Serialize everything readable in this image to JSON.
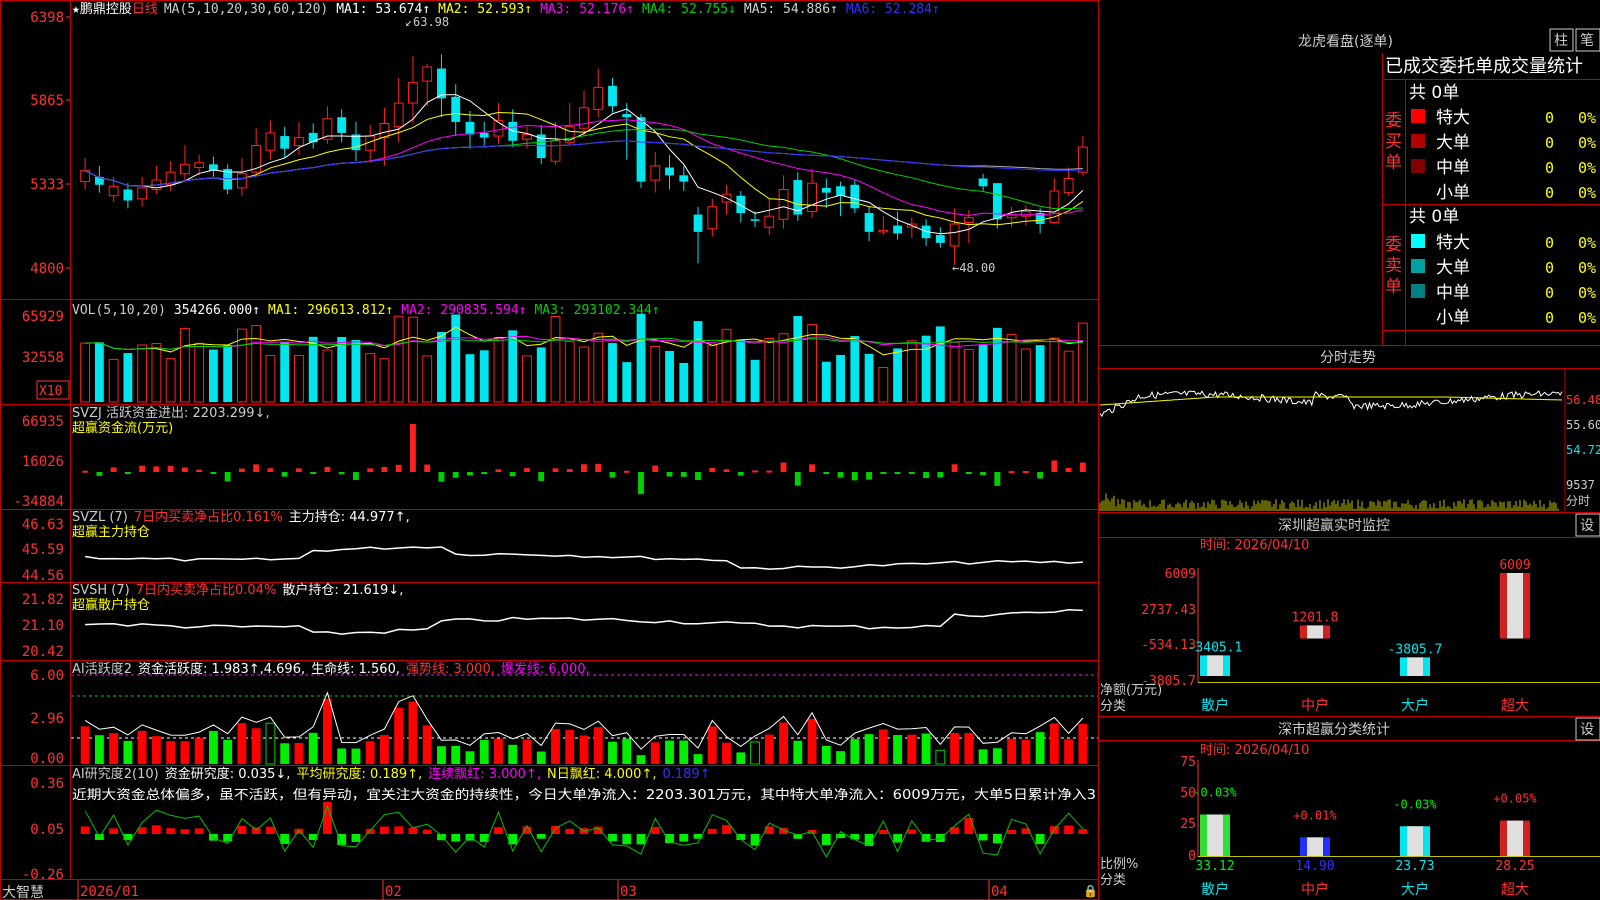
{
  "colors": {
    "up": "#ff2020",
    "down": "#00e5ee",
    "grid": "#c00000",
    "axis": "#ff3030",
    "ma1": "#ffffff",
    "ma2": "#ffff00",
    "ma3": "#ff00ff",
    "ma4": "#00d000",
    "ma5": "#b0b0b0",
    "ma6": "#3030ff"
  },
  "app": {
    "name": "大智慧",
    "stock": "鹏鼎控股",
    "period": "日线",
    "star": "★"
  },
  "main_legend": {
    "ma_params": "MA(5,10,20,30,60,120)",
    "ma1": "MA1: 53.674↑",
    "ma2": "MA2: 52.593↑",
    "ma3": "MA3: 52.176↑",
    "ma4": "MA4: 52.755↓",
    "ma5": "MA5: 54.886↑",
    "ma6": "MA6: 52.284↑"
  },
  "main_axis": [
    "6398",
    "5865",
    "5333",
    "4800"
  ],
  "annotations": {
    "high": "63.98",
    "low": "←48.00"
  },
  "vol": {
    "legend": "VOL(5,10,20)",
    "value": "354266.000↑",
    "ma1": "MA1: 296613.812↑",
    "ma2": "MA2: 290835.594↑",
    "ma3": "MA3: 293102.344↑",
    "axis": [
      "65929",
      "32558"
    ],
    "unit": "X10"
  },
  "svzj": {
    "line1": "SVZJ  活跃资金进出: 2203.299↓,",
    "line2": "超赢资金流(万元)",
    "axis": [
      "66935",
      "16026",
      "-34884"
    ]
  },
  "svzl": {
    "line1a": "SVZL (7)",
    "line1b": "7日内买卖净占比0.161%",
    "line1c": "主力持仓: 44.977↑,",
    "line2": "超赢主力持仓",
    "axis": [
      "46.63",
      "45.59",
      "44.56"
    ]
  },
  "svsh": {
    "line1a": "SVSH (7)",
    "line1b": "7日内买卖净占比0.04%",
    "line1c": "散户持仓: 21.619↓,",
    "line2": "超赢散户持仓",
    "axis": [
      "21.82",
      "21.10",
      "20.42"
    ]
  },
  "ai1": {
    "a": "AI活跃度2",
    "b": "资金活跃度: 1.983↑,4.696,",
    "c": "生命线: 1.560,",
    "d": "强势线: 3.000,",
    "e": "爆发线: 6.000,",
    "axis": [
      "6.00",
      "2.96",
      "0.00"
    ]
  },
  "ai2": {
    "a": "AI研究度2(10)",
    "b": "资金研究度: 0.035↓,",
    "c": "平均研究度: 0.189↑,",
    "d": "连续飘红: 3.000↑,",
    "e": "N日飘红: 4.000↑,",
    "f": "0.189↑",
    "note": "近期大资金总体偏多，虽不活跃，但有异动，宜关注大资金的持续性，今日大单净流入：2203.301万元，其中特大单净流入：6009万元，大单5日累计净入3",
    "axis": [
      "0.36",
      "0.05",
      "-0.26"
    ]
  },
  "dates": [
    "2026/01",
    "02",
    "03",
    "04"
  ],
  "right": {
    "lhkp_title": "龙虎看盘(逐单)",
    "btn_zhu": "柱",
    "btn_bi": "笔",
    "tabs": "已成交委托单成交量统计",
    "buy": {
      "label": "委买单",
      "total": "共 0单",
      "rows": [
        {
          "name": "特大",
          "color": "#ff0000",
          "count": "0",
          "pct": "0%"
        },
        {
          "name": "大单",
          "color": "#b00000",
          "count": "0",
          "pct": "0%"
        },
        {
          "name": "中单",
          "color": "#800000",
          "count": "0",
          "pct": "0%"
        },
        {
          "name": "小单",
          "color": "#000000",
          "count": "0",
          "pct": "0%"
        }
      ]
    },
    "sell": {
      "label": "委卖单",
      "total": "共 0单",
      "rows": [
        {
          "name": "特大",
          "color": "#00ffff",
          "count": "0",
          "pct": "0%"
        },
        {
          "name": "大单",
          "color": "#00a0a0",
          "count": "0",
          "pct": "0%"
        },
        {
          "name": "中单",
          "color": "#008080",
          "count": "0",
          "pct": "0%"
        },
        {
          "name": "小单",
          "color": "#000000",
          "count": "0",
          "pct": "0%"
        }
      ]
    },
    "fs_title": "分时走势",
    "fs_axis": [
      "56.48",
      "55.60",
      "54.72",
      "9537",
      "分时"
    ],
    "monitor": {
      "title": "深圳超赢实时监控",
      "set": "设",
      "time": "时间: 2026/04/10",
      "axis": [
        "6009",
        "2737.43",
        "-534.13",
        "-3805.7"
      ],
      "ylabel": "净额(万元)",
      "xlabel": "分类",
      "cats": [
        "散户",
        "中户",
        "大户",
        "超大"
      ],
      "values": [
        -3405.1,
        1201.8,
        -3805.7,
        6009
      ],
      "labels": [
        "-3405.1",
        "1201.8",
        "-3805.7",
        "6009"
      ]
    },
    "classify": {
      "title": "深市超赢分类统计",
      "set": "设",
      "time": "时间: 2026/04/10",
      "axis": [
        "75",
        "50",
        "25",
        "0"
      ],
      "ylabel": "比例%",
      "xlabel": "分类",
      "cats": [
        "散户",
        "中户",
        "大户",
        "超大"
      ],
      "values": [
        33.12,
        14.9,
        23.73,
        28.25
      ],
      "labels": [
        "33.12",
        "14.90",
        "23.73",
        "28.25"
      ],
      "changes": [
        "-0.03%",
        "+0.01%",
        "-0.03%",
        "+0.05%"
      ]
    }
  },
  "chart_data": [
    {
      "type": "candlestick",
      "title": "鹏鼎控股 日线",
      "ylim": [
        48.0,
        63.98
      ],
      "x": [
        "2026/01",
        "02",
        "03",
        "04"
      ],
      "series": [
        {
          "name": "K线",
          "candles": [
            [
              53.5,
              54.2,
              55.0,
              53.0
            ],
            [
              53.8,
              53.3,
              54.5,
              52.8
            ],
            [
              52.6,
              53.2,
              53.8,
              52.2
            ],
            [
              53.0,
              52.3,
              53.4,
              51.8
            ],
            [
              52.4,
              53.1,
              53.8,
              51.9
            ],
            [
              53.0,
              53.6,
              54.5,
              52.7
            ],
            [
              53.3,
              54.1,
              54.8,
              52.9
            ],
            [
              54.0,
              54.6,
              55.8,
              53.6
            ],
            [
              54.4,
              54.7,
              55.2,
              53.9
            ],
            [
              54.6,
              54.2,
              55.1,
              53.8
            ],
            [
              54.3,
              53.0,
              54.6,
              52.7
            ],
            [
              53.1,
              54.0,
              55.0,
              52.6
            ],
            [
              54.1,
              55.8,
              56.9,
              53.9
            ],
            [
              55.5,
              56.6,
              57.4,
              54.9
            ],
            [
              56.4,
              55.6,
              57.0,
              55.0
            ],
            [
              55.8,
              56.3,
              57.3,
              55.2
            ],
            [
              56.6,
              56.0,
              57.2,
              55.6
            ],
            [
              56.2,
              57.5,
              58.3,
              55.9
            ],
            [
              57.6,
              56.6,
              58.1,
              56.0
            ],
            [
              56.5,
              55.5,
              57.3,
              54.8
            ],
            [
              55.5,
              56.4,
              57.1,
              54.7
            ],
            [
              56.3,
              57.2,
              58.2,
              54.5
            ],
            [
              57.0,
              58.5,
              60.1,
              56.0
            ],
            [
              58.5,
              59.8,
              61.5,
              57.2
            ],
            [
              59.9,
              60.8,
              61.0,
              58.3
            ],
            [
              60.7,
              58.8,
              61.6,
              57.6
            ],
            [
              58.9,
              57.3,
              59.7,
              56.4
            ],
            [
              57.3,
              56.5,
              58.0,
              55.6
            ],
            [
              56.6,
              56.3,
              57.3,
              55.8
            ],
            [
              56.4,
              57.4,
              58.5,
              55.9
            ],
            [
              57.3,
              56.1,
              58.1,
              55.7
            ],
            [
              56.2,
              56.5,
              57.0,
              55.6
            ],
            [
              56.5,
              55.0,
              57.1,
              54.6
            ],
            [
              54.8,
              56.1,
              57.3,
              54.6
            ],
            [
              56.0,
              57.0,
              58.5,
              55.8
            ],
            [
              56.9,
              58.2,
              59.3,
              56.4
            ],
            [
              58.1,
              59.5,
              60.7,
              57.6
            ],
            [
              59.6,
              58.3,
              60.1,
              57.9
            ],
            [
              57.8,
              57.6,
              58.5,
              54.9
            ],
            [
              57.6,
              53.5,
              57.8,
              53.1
            ],
            [
              53.6,
              54.5,
              55.4,
              52.8
            ],
            [
              54.4,
              53.9,
              55.2,
              53.0
            ],
            [
              53.9,
              53.5,
              54.5,
              52.9
            ],
            [
              51.4,
              50.3,
              51.9,
              48.3
            ],
            [
              50.5,
              51.9,
              52.4,
              50.0
            ],
            [
              52.2,
              52.7,
              53.3,
              51.4
            ],
            [
              52.6,
              51.5,
              52.9,
              50.9
            ],
            [
              51.1,
              51.0,
              51.6,
              50.6
            ],
            [
              50.6,
              51.3,
              52.4,
              50.1
            ],
            [
              51.1,
              53.0,
              53.9,
              50.5
            ],
            [
              53.6,
              51.4,
              54.1,
              51.0
            ],
            [
              51.6,
              53.4,
              54.3,
              51.2
            ],
            [
              53.1,
              52.8,
              53.7,
              51.8
            ],
            [
              53.2,
              52.6,
              53.5,
              51.3
            ],
            [
              53.3,
              51.8,
              53.6,
              51.5
            ],
            [
              51.5,
              50.3,
              51.9,
              49.7
            ],
            [
              50.3,
              50.4,
              51.3,
              50.1
            ],
            [
              50.7,
              50.2,
              51.6,
              49.8
            ],
            [
              50.6,
              50.8,
              51.2,
              49.9
            ],
            [
              50.7,
              49.9,
              51.1,
              49.4
            ],
            [
              50.1,
              49.6,
              50.6,
              49.3
            ],
            [
              49.4,
              50.8,
              51.8,
              48.2
            ],
            [
              50.9,
              51.2,
              51.7,
              49.6
            ],
            [
              53.7,
              53.2,
              54.0,
              52.9
            ],
            [
              53.4,
              51.1,
              53.4,
              50.5
            ],
            [
              51.2,
              51.4,
              51.9,
              50.6
            ],
            [
              51.3,
              51.6,
              52.0,
              50.7
            ],
            [
              51.5,
              50.8,
              51.8,
              50.2
            ],
            [
              50.9,
              52.9,
              53.7,
              50.8
            ],
            [
              52.8,
              53.7,
              54.4,
              52.6
            ],
            [
              54.1,
              55.7,
              56.4,
              53.9
            ]
          ]
        }
      ]
    },
    {
      "type": "bar",
      "title": "深圳超赢实时监控",
      "xlabel": "分类",
      "ylabel": "净额(万元)",
      "categories": [
        "散户",
        "中户",
        "大户",
        "超大"
      ],
      "values": [
        -3405.1,
        1201.8,
        -3805.7,
        6009
      ],
      "ylim": [
        -3805.7,
        6009
      ]
    },
    {
      "type": "bar",
      "title": "深市超赢分类统计",
      "xlabel": "分类",
      "ylabel": "比例%",
      "categories": [
        "散户",
        "中户",
        "大户",
        "超大"
      ],
      "values": [
        33.12,
        14.9,
        23.73,
        28.25
      ],
      "ylim": [
        0,
        75
      ]
    }
  ]
}
